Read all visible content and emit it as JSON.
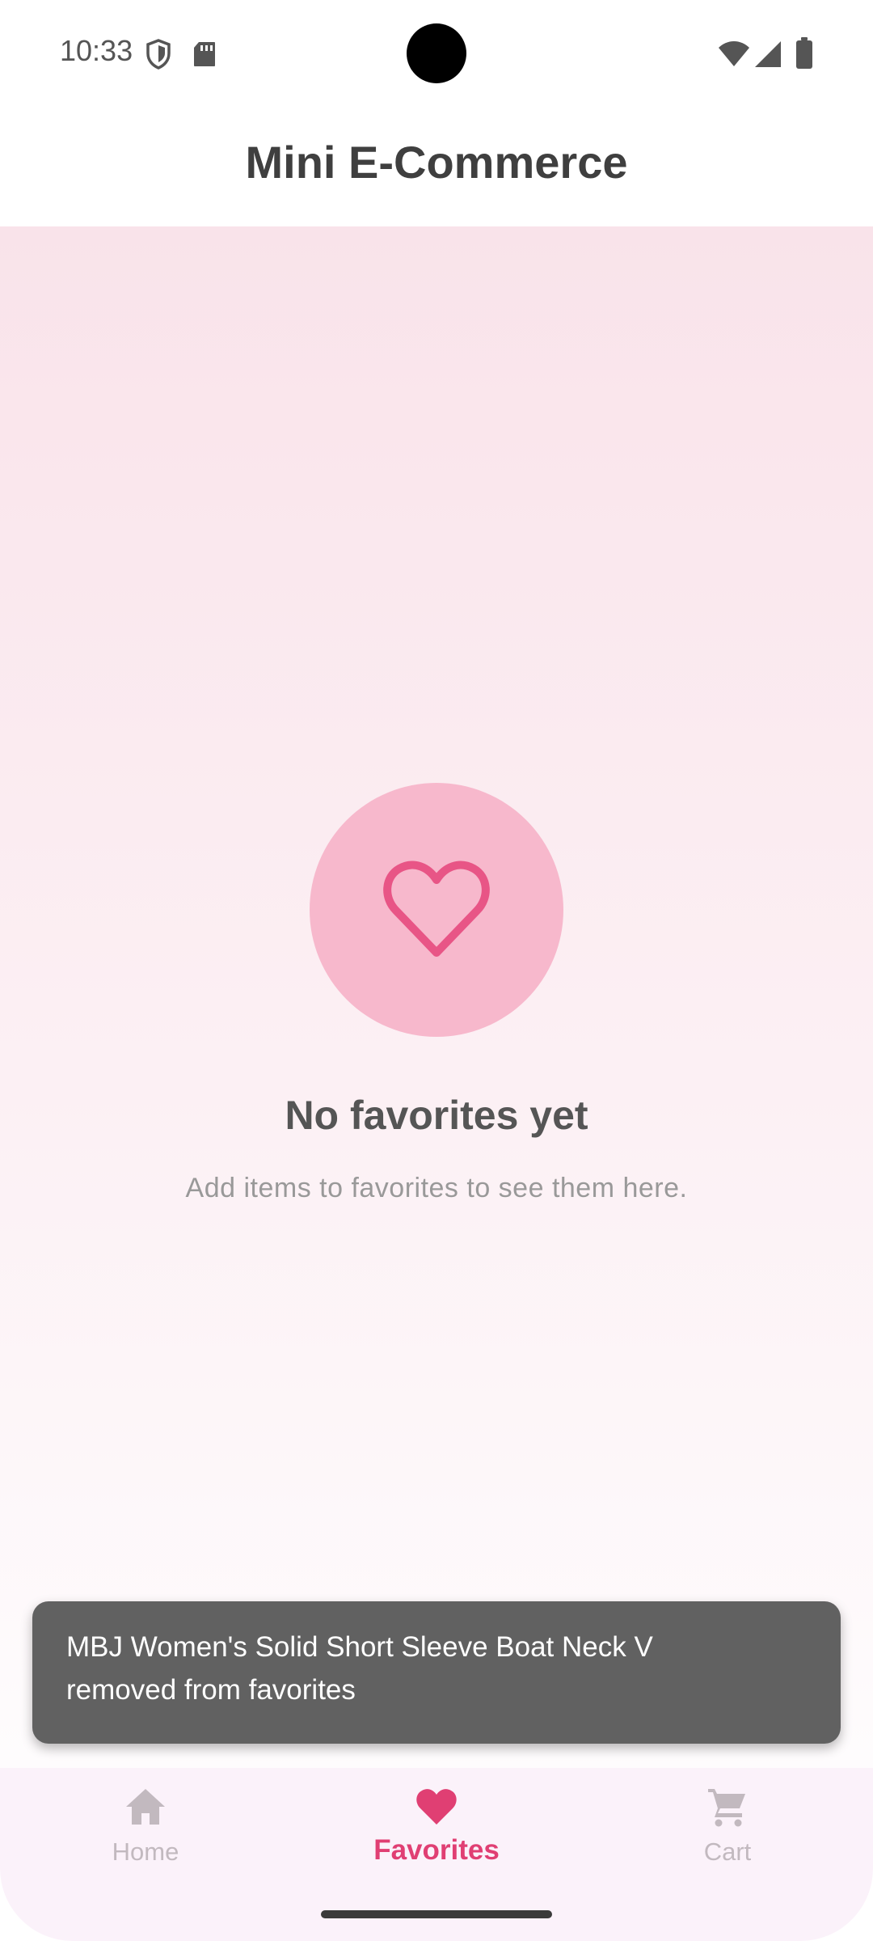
{
  "status_bar": {
    "time": "10:33",
    "icons": [
      "shield-icon",
      "sd-card-icon",
      "wifi-icon",
      "signal-icon",
      "battery-icon"
    ]
  },
  "app_bar": {
    "title": "Mini E-Commerce"
  },
  "empty_state": {
    "icon": "heart-outline-icon",
    "title": "No favorites yet",
    "subtitle": "Add items to favorites to see them here."
  },
  "snackbar": {
    "message": "MBJ Women's Solid Short Sleeve Boat Neck V removed from favorites"
  },
  "bottom_nav": {
    "items": [
      {
        "label": "Home",
        "icon": "home-icon",
        "active": false
      },
      {
        "label": "Favorites",
        "icon": "heart-icon",
        "active": true
      },
      {
        "label": "Cart",
        "icon": "cart-icon",
        "active": false
      }
    ]
  },
  "colors": {
    "accent": "#e03f73",
    "heart_circle": "#f7b8cc",
    "snackbar_bg": "#616161",
    "nav_bg": "#fbf2fa",
    "inactive": "#c2b9bf"
  }
}
